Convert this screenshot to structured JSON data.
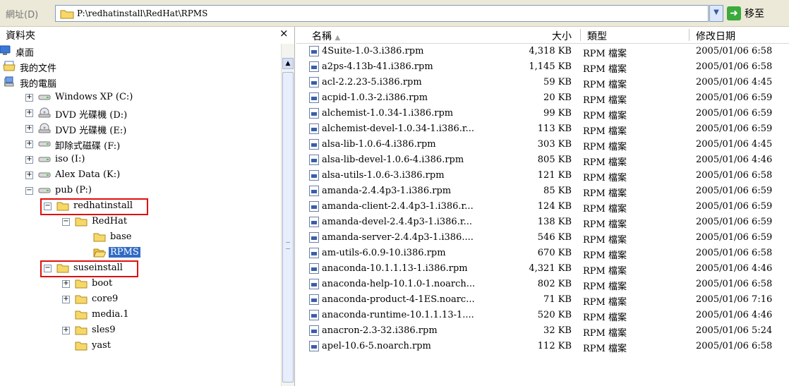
{
  "address": {
    "label": "網址(D)",
    "path": "P:\\redhatinstall\\RedHat\\RPMS",
    "go_label": "移至"
  },
  "tree": {
    "title": "資料夾",
    "close": "×",
    "nodes": [
      {
        "label": "桌面",
        "icon": "desktop-icon",
        "expander": "",
        "level": 0
      },
      {
        "label": "我的文件",
        "icon": "my-documents-icon",
        "expander": "+",
        "level": 0
      },
      {
        "label": "我的電腦",
        "icon": "my-computer-icon",
        "expander": "−",
        "level": 0
      },
      {
        "label": "Windows XP (C:)",
        "icon": "drive-icon",
        "expander": "+",
        "level": 1
      },
      {
        "label": "DVD 光碟機 (D:)",
        "icon": "dvd-drive-icon",
        "expander": "+",
        "level": 1
      },
      {
        "label": "DVD 光碟機 (E:)",
        "icon": "dvd-drive-icon",
        "expander": "+",
        "level": 1
      },
      {
        "label": "卸除式磁碟 (F:)",
        "icon": "drive-icon",
        "expander": "+",
        "level": 1
      },
      {
        "label": "iso (I:)",
        "icon": "drive-icon",
        "expander": "+",
        "level": 1
      },
      {
        "label": "Alex Data (K:)",
        "icon": "drive-icon",
        "expander": "+",
        "level": 1
      },
      {
        "label": "pub (P:)",
        "icon": "drive-icon",
        "expander": "−",
        "level": 1
      },
      {
        "label": "redhatinstall",
        "icon": "folder-icon",
        "expander": "−",
        "level": 2,
        "highlight": true
      },
      {
        "label": "RedHat",
        "icon": "folder-icon",
        "expander": "−",
        "level": 3
      },
      {
        "label": "base",
        "icon": "folder-icon",
        "expander": "",
        "level": 4
      },
      {
        "label": "RPMS",
        "icon": "folder-open-icon",
        "expander": "",
        "level": 4,
        "selected": true
      },
      {
        "label": "suseinstall",
        "icon": "folder-icon",
        "expander": "−",
        "level": 2,
        "highlight": true
      },
      {
        "label": "boot",
        "icon": "folder-icon",
        "expander": "+",
        "level": 3
      },
      {
        "label": "core9",
        "icon": "folder-icon",
        "expander": "+",
        "level": 3
      },
      {
        "label": "media.1",
        "icon": "folder-icon",
        "expander": "",
        "level": 3
      },
      {
        "label": "sles9",
        "icon": "folder-icon",
        "expander": "+",
        "level": 3
      },
      {
        "label": "yast",
        "icon": "folder-icon",
        "expander": "",
        "level": 3
      }
    ]
  },
  "list": {
    "columns": {
      "name": "名稱",
      "size": "大小",
      "type": "類型",
      "modified": "修改日期"
    },
    "files": [
      {
        "name": "4Suite-1.0-3.i386.rpm",
        "size": "4,318 KB",
        "type": "RPM 檔案",
        "date": "2005/01/06 6:58"
      },
      {
        "name": "a2ps-4.13b-41.i386.rpm",
        "size": "1,145 KB",
        "type": "RPM 檔案",
        "date": "2005/01/06 6:58"
      },
      {
        "name": "acl-2.2.23-5.i386.rpm",
        "size": "59 KB",
        "type": "RPM 檔案",
        "date": "2005/01/06 4:45"
      },
      {
        "name": "acpid-1.0.3-2.i386.rpm",
        "size": "20 KB",
        "type": "RPM 檔案",
        "date": "2005/01/06 6:59"
      },
      {
        "name": "alchemist-1.0.34-1.i386.rpm",
        "size": "99 KB",
        "type": "RPM 檔案",
        "date": "2005/01/06 6:59"
      },
      {
        "name": "alchemist-devel-1.0.34-1.i386.r...",
        "size": "113 KB",
        "type": "RPM 檔案",
        "date": "2005/01/06 6:59"
      },
      {
        "name": "alsa-lib-1.0.6-4.i386.rpm",
        "size": "303 KB",
        "type": "RPM 檔案",
        "date": "2005/01/06 4:45"
      },
      {
        "name": "alsa-lib-devel-1.0.6-4.i386.rpm",
        "size": "805 KB",
        "type": "RPM 檔案",
        "date": "2005/01/06 4:46"
      },
      {
        "name": "alsa-utils-1.0.6-3.i386.rpm",
        "size": "121 KB",
        "type": "RPM 檔案",
        "date": "2005/01/06 6:58"
      },
      {
        "name": "amanda-2.4.4p3-1.i386.rpm",
        "size": "85 KB",
        "type": "RPM 檔案",
        "date": "2005/01/06 6:59"
      },
      {
        "name": "amanda-client-2.4.4p3-1.i386.r...",
        "size": "124 KB",
        "type": "RPM 檔案",
        "date": "2005/01/06 6:59"
      },
      {
        "name": "amanda-devel-2.4.4p3-1.i386.r...",
        "size": "138 KB",
        "type": "RPM 檔案",
        "date": "2005/01/06 6:59"
      },
      {
        "name": "amanda-server-2.4.4p3-1.i386....",
        "size": "546 KB",
        "type": "RPM 檔案",
        "date": "2005/01/06 6:59"
      },
      {
        "name": "am-utils-6.0.9-10.i386.rpm",
        "size": "670 KB",
        "type": "RPM 檔案",
        "date": "2005/01/06 6:58"
      },
      {
        "name": "anaconda-10.1.1.13-1.i386.rpm",
        "size": "4,321 KB",
        "type": "RPM 檔案",
        "date": "2005/01/06 4:46"
      },
      {
        "name": "anaconda-help-10.1.0-1.noarch...",
        "size": "802 KB",
        "type": "RPM 檔案",
        "date": "2005/01/06 6:58"
      },
      {
        "name": "anaconda-product-4-1ES.noarc...",
        "size": "71 KB",
        "type": "RPM 檔案",
        "date": "2005/01/06 7:16"
      },
      {
        "name": "anaconda-runtime-10.1.1.13-1....",
        "size": "520 KB",
        "type": "RPM 檔案",
        "date": "2005/01/06 4:46"
      },
      {
        "name": "anacron-2.3-32.i386.rpm",
        "size": "32 KB",
        "type": "RPM 檔案",
        "date": "2005/01/06 5:24"
      },
      {
        "name": "apel-10.6-5.noarch.rpm",
        "size": "112 KB",
        "type": "RPM 檔案",
        "date": "2005/01/06 6:58"
      }
    ]
  }
}
